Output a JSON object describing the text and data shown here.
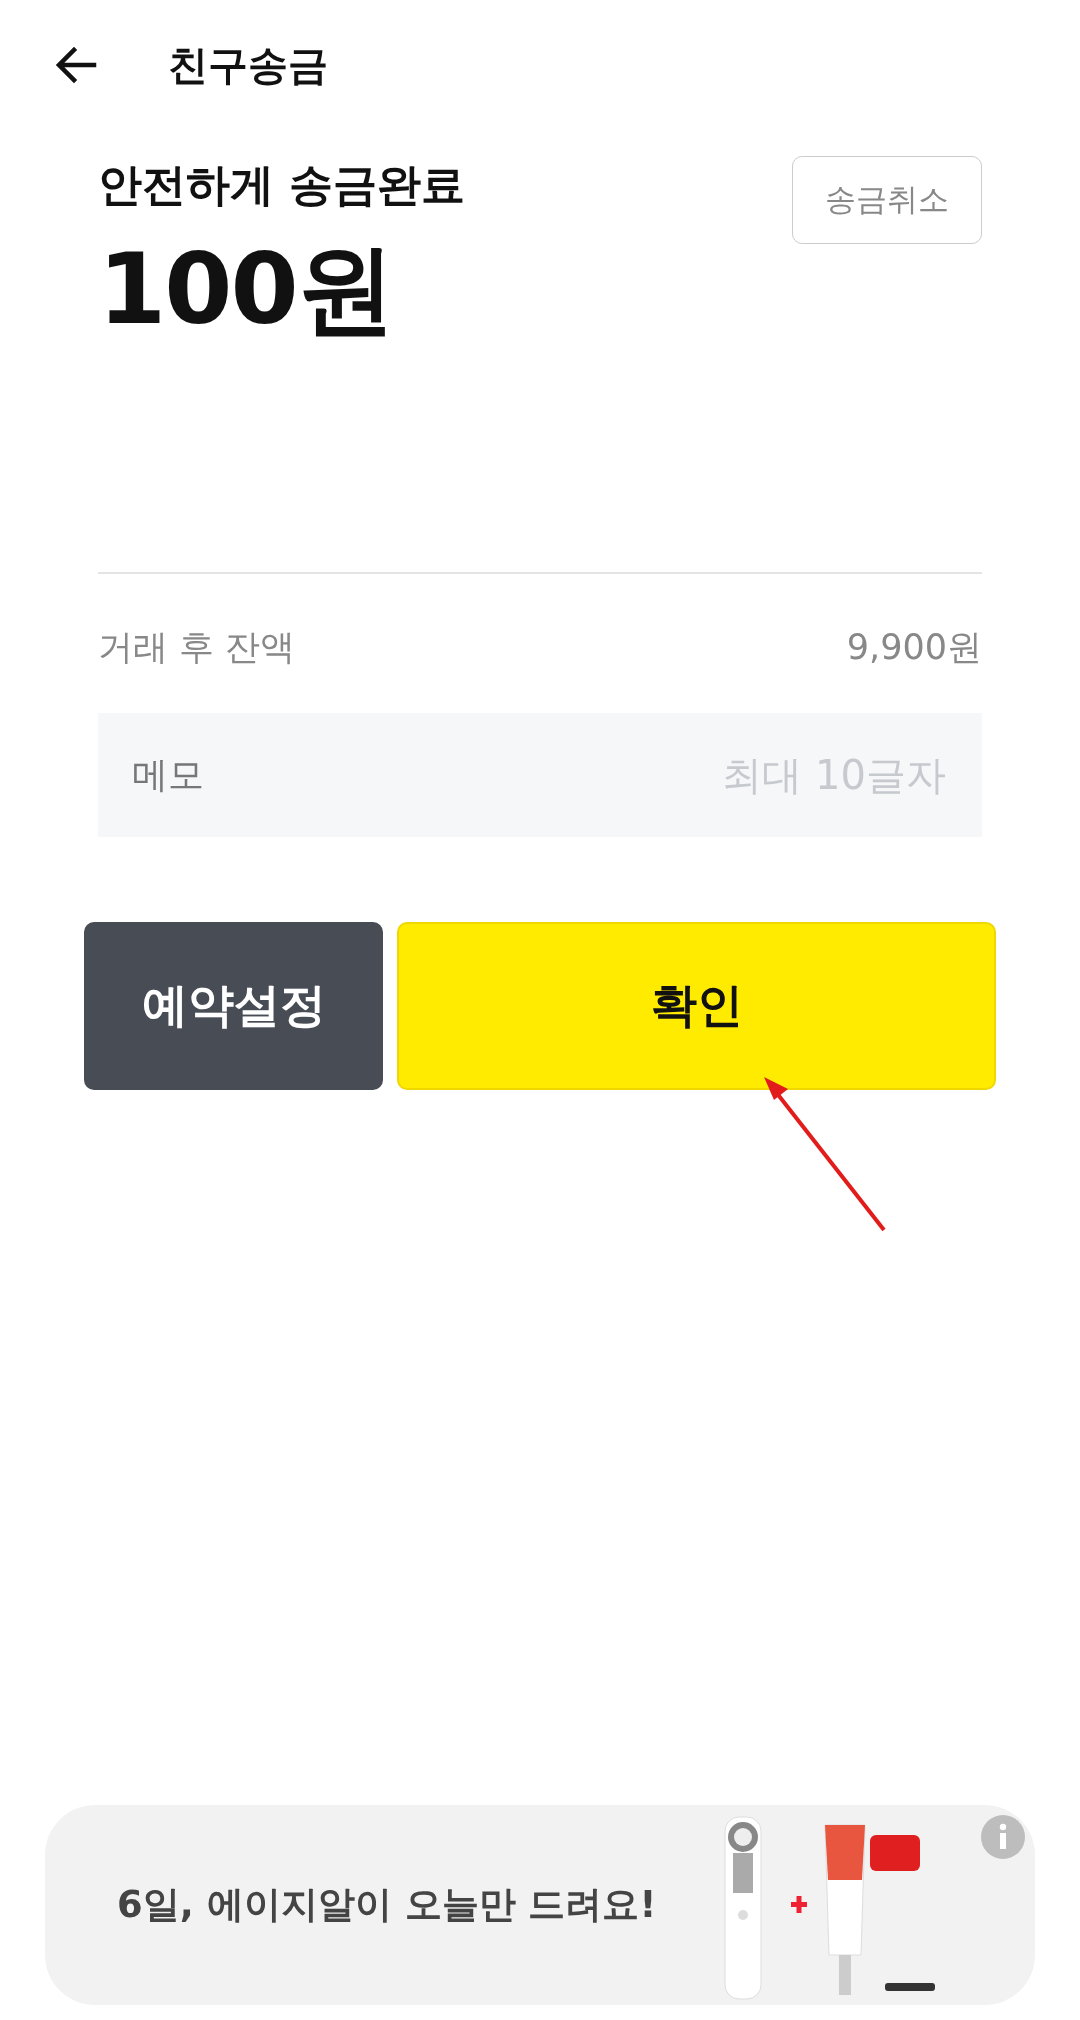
{
  "header": {
    "title": "친구송금"
  },
  "result": {
    "status": "안전하게 송금완료",
    "amount": "100원",
    "cancel_button": "송금취소"
  },
  "balance": {
    "label": "거래 후 잔액",
    "value": "9,900원"
  },
  "memo": {
    "label": "메모",
    "placeholder": "최대 10글자"
  },
  "buttons": [
    {
      "label": "예약설정",
      "kind": "secondary"
    },
    {
      "label": "확인",
      "kind": "primary"
    }
  ],
  "annotation": {
    "kind": "arrow"
  },
  "ad_banner": {
    "text": "6일, 에이지알이 오늘만 드려요!"
  }
}
